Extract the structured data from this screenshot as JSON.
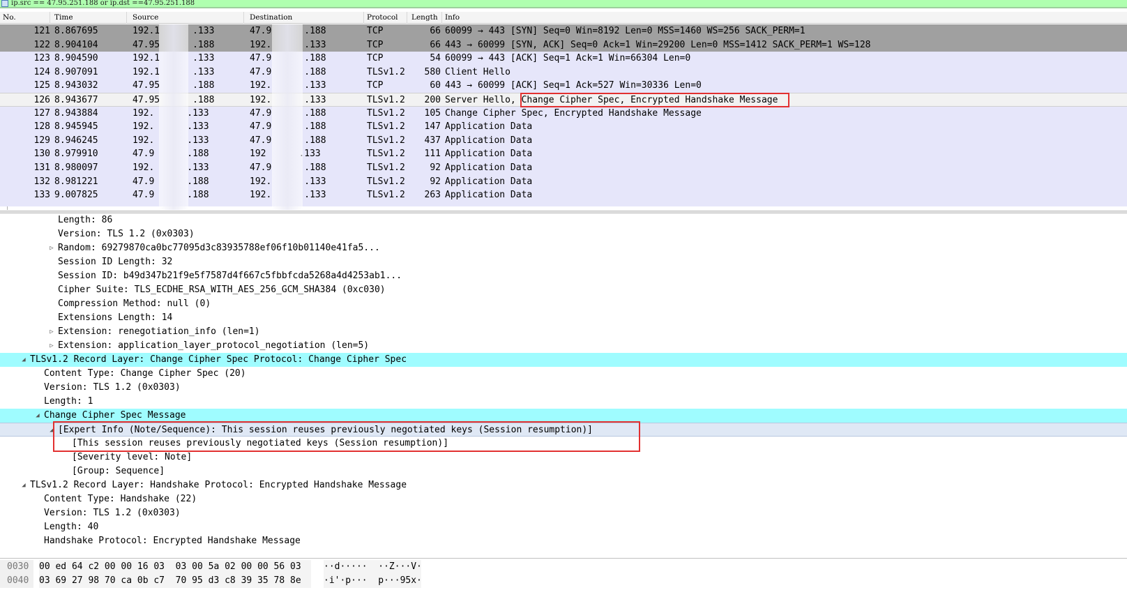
{
  "filter": {
    "text": "ip.src == 47.95.251.188 or ip.dst ==47.95.251.188",
    "icon": "bookmark-icon"
  },
  "columns": [
    "No.",
    "Time",
    "Source",
    "Destination",
    "Protocol",
    "Length",
    "Info"
  ],
  "packets": [
    {
      "no": "121",
      "time": "8.867695",
      "src": "192.1      .133",
      "dst": "47.9      .188",
      "proto": "TCP",
      "len": "66",
      "info": "60099 → 443 [SYN] Seq=0 Win=8192 Len=0 MSS=1460 WS=256 SACK_PERM=1",
      "style": "dark"
    },
    {
      "no": "122",
      "time": "8.904104",
      "src": "47.95      .188",
      "dst": "192.      .133",
      "proto": "TCP",
      "len": "66",
      "info": "443 → 60099 [SYN, ACK] Seq=0 Ack=1 Win=29200 Len=0 MSS=1412 SACK_PERM=1 WS=128",
      "style": "dark"
    },
    {
      "no": "123",
      "time": "8.904590",
      "src": "192.1      .133",
      "dst": "47.9      .188",
      "proto": "TCP",
      "len": "54",
      "info": "60099 → 443 [ACK] Seq=1 Ack=1 Win=66304 Len=0",
      "style": "normal"
    },
    {
      "no": "124",
      "time": "8.907091",
      "src": "192.1      .133",
      "dst": "47.9      .188",
      "proto": "TLSv1.2",
      "len": "580",
      "info": "Client Hello",
      "style": "normal"
    },
    {
      "no": "125",
      "time": "8.943032",
      "src": "47.95      .188",
      "dst": "192.      .133",
      "proto": "TCP",
      "len": "60",
      "info": "443 → 60099 [ACK] Seq=1 Ack=527 Win=30336 Len=0",
      "style": "normal"
    },
    {
      "no": "126",
      "time": "8.943677",
      "src": "47.95      .188",
      "dst": "192.      .133",
      "proto": "TLSv1.2",
      "len": "200",
      "info": "Server Hello, Change Cipher Spec, Encrypted Handshake Message",
      "style": "selected"
    },
    {
      "no": "127",
      "time": "8.943884",
      "src": "192.      .133",
      "dst": "47.9      .188",
      "proto": "TLSv1.2",
      "len": "105",
      "info": "Change Cipher Spec, Encrypted Handshake Message",
      "style": "normal"
    },
    {
      "no": "128",
      "time": "8.945945",
      "src": "192.      .133",
      "dst": "47.9      .188",
      "proto": "TLSv1.2",
      "len": "147",
      "info": "Application Data",
      "style": "normal"
    },
    {
      "no": "129",
      "time": "8.946245",
      "src": "192.      .133",
      "dst": "47.9      .188",
      "proto": "TLSv1.2",
      "len": "437",
      "info": "Application Data",
      "style": "normal"
    },
    {
      "no": "130",
      "time": "8.979910",
      "src": "47.9      .188",
      "dst": "192      .133",
      "proto": "TLSv1.2",
      "len": "111",
      "info": "Application Data",
      "style": "normal"
    },
    {
      "no": "131",
      "time": "8.980097",
      "src": "192.      .133",
      "dst": "47.9      .188",
      "proto": "TLSv1.2",
      "len": "92",
      "info": "Application Data",
      "style": "normal"
    },
    {
      "no": "132",
      "time": "8.981221",
      "src": "47.9      .188",
      "dst": "192.      .133",
      "proto": "TLSv1.2",
      "len": "92",
      "info": "Application Data",
      "style": "normal"
    },
    {
      "no": "133",
      "time": "9.007825",
      "src": "47.9      .188",
      "dst": "192.      .133",
      "proto": "TLSv1.2",
      "len": "263",
      "info": "Application Data",
      "style": "normal"
    }
  ],
  "details": [
    {
      "indent": 4,
      "twisty": "",
      "text": "Length: 86",
      "style": ""
    },
    {
      "indent": 4,
      "twisty": "",
      "text": "Version: TLS 1.2 (0x0303)",
      "style": ""
    },
    {
      "indent": 4,
      "twisty": "▷",
      "text": "Random: 69279870ca0bc77095d3c83935788ef06f10b01140e41fa5...",
      "style": ""
    },
    {
      "indent": 4,
      "twisty": "",
      "text": "Session ID Length: 32",
      "style": ""
    },
    {
      "indent": 4,
      "twisty": "",
      "text": "Session ID: b49d347b21f9e5f7587d4f667c5fbbfcda5268a4d4253ab1...",
      "style": ""
    },
    {
      "indent": 4,
      "twisty": "",
      "text": "Cipher Suite: TLS_ECDHE_RSA_WITH_AES_256_GCM_SHA384 (0xc030)",
      "style": ""
    },
    {
      "indent": 4,
      "twisty": "",
      "text": "Compression Method: null (0)",
      "style": ""
    },
    {
      "indent": 4,
      "twisty": "",
      "text": "Extensions Length: 14",
      "style": ""
    },
    {
      "indent": 4,
      "twisty": "▷",
      "text": "Extension: renegotiation_info (len=1)",
      "style": ""
    },
    {
      "indent": 4,
      "twisty": "▷",
      "text": "Extension: application_layer_protocol_negotiation (len=5)",
      "style": ""
    },
    {
      "indent": 2,
      "twisty": "◢",
      "text": "TLSv1.2 Record Layer: Change Cipher Spec Protocol: Change Cipher Spec",
      "style": "cyan"
    },
    {
      "indent": 3,
      "twisty": "",
      "text": "Content Type: Change Cipher Spec (20)",
      "style": ""
    },
    {
      "indent": 3,
      "twisty": "",
      "text": "Version: TLS 1.2 (0x0303)",
      "style": ""
    },
    {
      "indent": 3,
      "twisty": "",
      "text": "Length: 1",
      "style": ""
    },
    {
      "indent": 3,
      "twisty": "◢",
      "text": "Change Cipher Spec Message",
      "style": "cyan"
    },
    {
      "indent": 4,
      "twisty": "◢",
      "text": "[Expert Info (Note/Sequence): This session reuses previously negotiated keys (Session resumption)]",
      "style": "bluesel"
    },
    {
      "indent": 5,
      "twisty": "",
      "text": "[This session reuses previously negotiated keys (Session resumption)]",
      "style": ""
    },
    {
      "indent": 5,
      "twisty": "",
      "text": "[Severity level: Note]",
      "style": ""
    },
    {
      "indent": 5,
      "twisty": "",
      "text": "[Group: Sequence]",
      "style": ""
    },
    {
      "indent": 2,
      "twisty": "◢",
      "text": "TLSv1.2 Record Layer: Handshake Protocol: Encrypted Handshake Message",
      "style": ""
    },
    {
      "indent": 3,
      "twisty": "",
      "text": "Content Type: Handshake (22)",
      "style": ""
    },
    {
      "indent": 3,
      "twisty": "",
      "text": "Version: TLS 1.2 (0x0303)",
      "style": ""
    },
    {
      "indent": 3,
      "twisty": "",
      "text": "Length: 40",
      "style": ""
    },
    {
      "indent": 3,
      "twisty": "",
      "text": "Handshake Protocol: Encrypted Handshake Message",
      "style": ""
    }
  ],
  "bytes": [
    {
      "offset": "0030",
      "hex": "00 ed 64 c2 00 00 16 03  03 00 5a 02 00 00 56 03",
      "ascii": "··d·····  ··Z···V·"
    },
    {
      "offset": "0040",
      "hex": "03 69 27 98 70 ca 0b c7  70 95 d3 c8 39 35 78 8e",
      "ascii": "·i'·p···  p···95x·"
    }
  ],
  "colors": {
    "row_normal": "#e6e6fa",
    "row_dark": "#a0a0a0",
    "detail_cyan": "#9ffcff",
    "highlight_red": "#e23030",
    "filter_green": "#afffaf"
  }
}
